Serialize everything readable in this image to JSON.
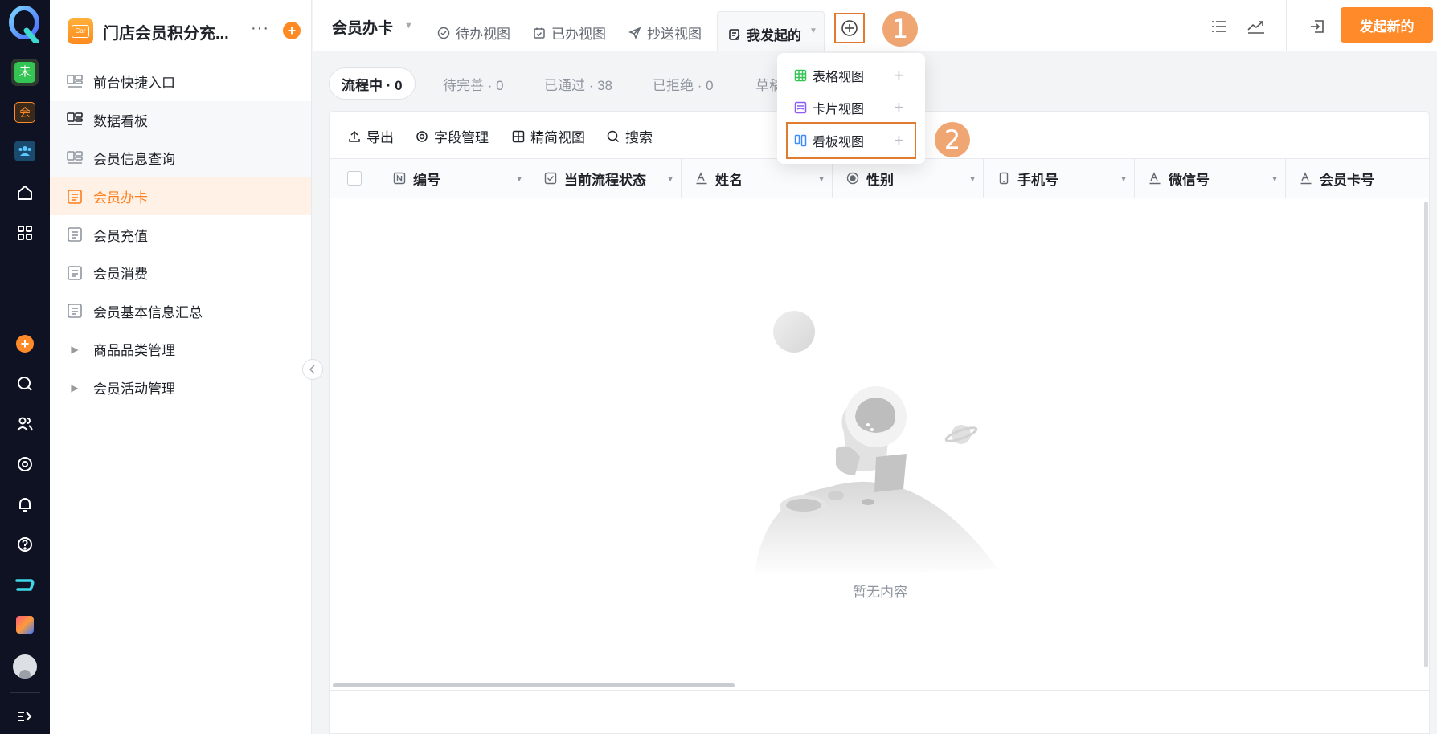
{
  "rail": {
    "icons": [
      "q-app-logo",
      "green-app-icon",
      "orange-app-icon",
      "blue-team-icon",
      "home-icon",
      "grid-icon",
      "orange-plus-icon",
      "search-icon",
      "people-icon",
      "target-icon",
      "bell-icon",
      "help-icon",
      "brand-icon",
      "photo-app-icon",
      "avatar",
      "expand-icon"
    ],
    "badges": {
      "green": "未",
      "orange": "会"
    }
  },
  "app": {
    "title": "门店会员积分充...",
    "logo_text": "Car",
    "more": "···"
  },
  "sidebar": {
    "items": [
      {
        "label": "前台快捷入口",
        "icon": "dashboard-icon"
      },
      {
        "label": "数据看板",
        "icon": "dashboard-icon"
      },
      {
        "label": "会员信息查询",
        "icon": "dashboard-icon"
      },
      {
        "label": "会员办卡",
        "icon": "form-icon"
      },
      {
        "label": "会员充值",
        "icon": "form-icon"
      },
      {
        "label": "会员消费",
        "icon": "form-icon"
      },
      {
        "label": "会员基本信息汇总",
        "icon": "form-icon"
      },
      {
        "label": "商品品类管理",
        "icon": "caret-right"
      },
      {
        "label": "会员活动管理",
        "icon": "caret-right"
      }
    ]
  },
  "topbar": {
    "form_name": "会员办卡",
    "tabs": [
      {
        "label": "待办视图",
        "icon": "check-circle-icon"
      },
      {
        "label": "已办视图",
        "icon": "calendar-check-icon"
      },
      {
        "label": "抄送视图",
        "icon": "send-icon"
      }
    ],
    "active_tab": "我发起的",
    "primary_button": "发起新的"
  },
  "callouts": {
    "one": "1",
    "two": "2"
  },
  "status_chips": [
    {
      "label": "流程中 · 0",
      "active": true
    },
    {
      "label": "待完善 · 0",
      "active": false
    },
    {
      "label": "已通过 · 38",
      "active": false
    },
    {
      "label": "已拒绝 · 0",
      "active": false
    },
    {
      "label": "草稿",
      "active": false
    }
  ],
  "toolbar": {
    "export": "导出",
    "fields": "字段管理",
    "compact": "精简视图",
    "search": "搜索"
  },
  "table": {
    "columns": [
      {
        "label": "编号",
        "icon": "number-icon"
      },
      {
        "label": "当前流程状态",
        "icon": "checkbox-icon"
      },
      {
        "label": "姓名",
        "icon": "text-icon"
      },
      {
        "label": "性别",
        "icon": "radio-icon"
      },
      {
        "label": "手机号",
        "icon": "phone-icon"
      },
      {
        "label": "微信号",
        "icon": "text-icon"
      },
      {
        "label": "会员卡号",
        "icon": "text-icon"
      }
    ],
    "empty_text": "暂无内容"
  },
  "view_menu": {
    "items": [
      {
        "label": "表格视图",
        "icon": "table-view-icon",
        "add": "+"
      },
      {
        "label": "卡片视图",
        "icon": "card-view-icon",
        "add": "+"
      },
      {
        "label": "看板视图",
        "icon": "kanban-view-icon",
        "add": "+"
      }
    ]
  },
  "colors": {
    "accent": "#ff8a2a",
    "rail_bg": "#0f1222",
    "active_bg": "#fff1e6",
    "highlight_border": "#e07b30",
    "callout": "#f0a673"
  }
}
